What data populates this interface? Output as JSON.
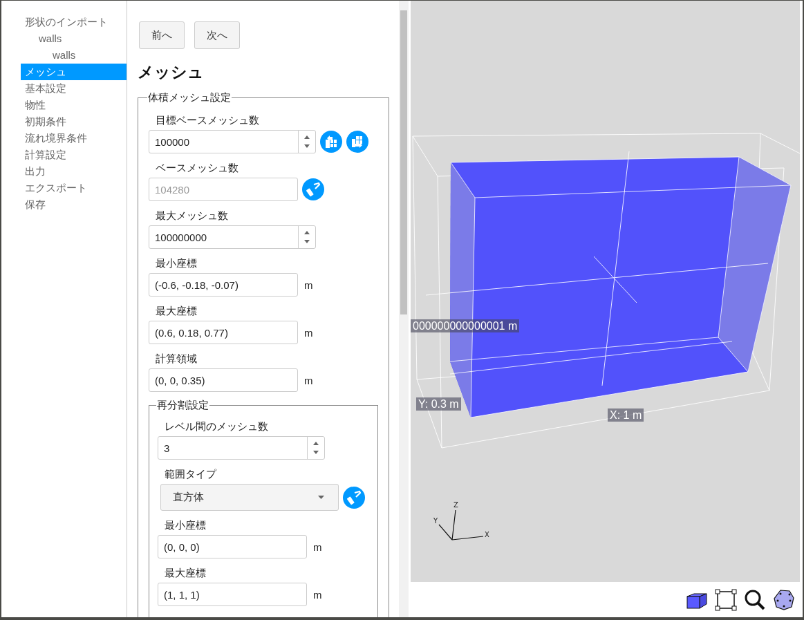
{
  "sidebar": {
    "items": [
      {
        "label": "形状のインポート",
        "selected": false,
        "children": [
          {
            "label": "walls",
            "selected": false,
            "children": [
              {
                "label": "walls",
                "selected": false
              }
            ]
          }
        ]
      },
      {
        "label": "メッシュ",
        "selected": true
      },
      {
        "label": "基本設定",
        "selected": false
      },
      {
        "label": "物性",
        "selected": false
      },
      {
        "label": "初期条件",
        "selected": false
      },
      {
        "label": "流れ境界条件",
        "selected": false
      },
      {
        "label": "計算設定",
        "selected": false
      },
      {
        "label": "出力",
        "selected": false
      },
      {
        "label": "エクスポート",
        "selected": false
      },
      {
        "label": "保存",
        "selected": false
      }
    ]
  },
  "nav_buttons": [
    "前へ",
    "次へ"
  ],
  "heading": "メッシュ",
  "volume_mesh": {
    "legend": "体積メッシュ設定",
    "fields": [
      {
        "label": "目標ベースメッシュ数",
        "kind": "number",
        "value": "100000",
        "disabled": false,
        "actions": [
          {
            "kind": "grid-in"
          },
          {
            "kind": "grid-out"
          }
        ]
      },
      {
        "label": "ベースメッシュ数",
        "kind": "text",
        "value": "104280",
        "disabled": true,
        "actions": [
          {
            "kind": "roller"
          }
        ]
      },
      {
        "label": "最大メッシュ数",
        "kind": "number",
        "value": "100000000",
        "disabled": false
      },
      {
        "label": "最小座標",
        "kind": "text",
        "value": "(-0.6, -0.18, -0.07)",
        "unit": "m",
        "disabled": false
      },
      {
        "label": "最大座標",
        "kind": "text",
        "value": "(0.6, 0.18, 0.77)",
        "unit": "m",
        "disabled": false
      },
      {
        "label": "計算領域",
        "kind": "text",
        "value": "(0, 0, 0.35)",
        "unit": "m",
        "disabled": false
      }
    ],
    "refinement": {
      "legend": "再分割設定",
      "fields": [
        {
          "label": "レベル間のメッシュ数",
          "kind": "number",
          "value": "3",
          "disabled": false
        },
        {
          "label": "範囲タイプ",
          "kind": "select",
          "value": "直方体",
          "disabled": false,
          "actions": [
            {
              "kind": "roller"
            }
          ]
        },
        {
          "label": "最小座標",
          "kind": "text",
          "value": "(0, 0, 0)",
          "unit": "m",
          "disabled": false
        },
        {
          "label": "最大座標",
          "kind": "text",
          "value": "(1, 1, 1)",
          "unit": "m",
          "disabled": false
        }
      ]
    }
  },
  "viewport": {
    "dimension_label": "000000000000001 m",
    "y_label": "Y: 0.3 m",
    "x_label": "X: 1 m",
    "axes": {
      "z": "Z",
      "y": "Y",
      "x": "X"
    }
  }
}
